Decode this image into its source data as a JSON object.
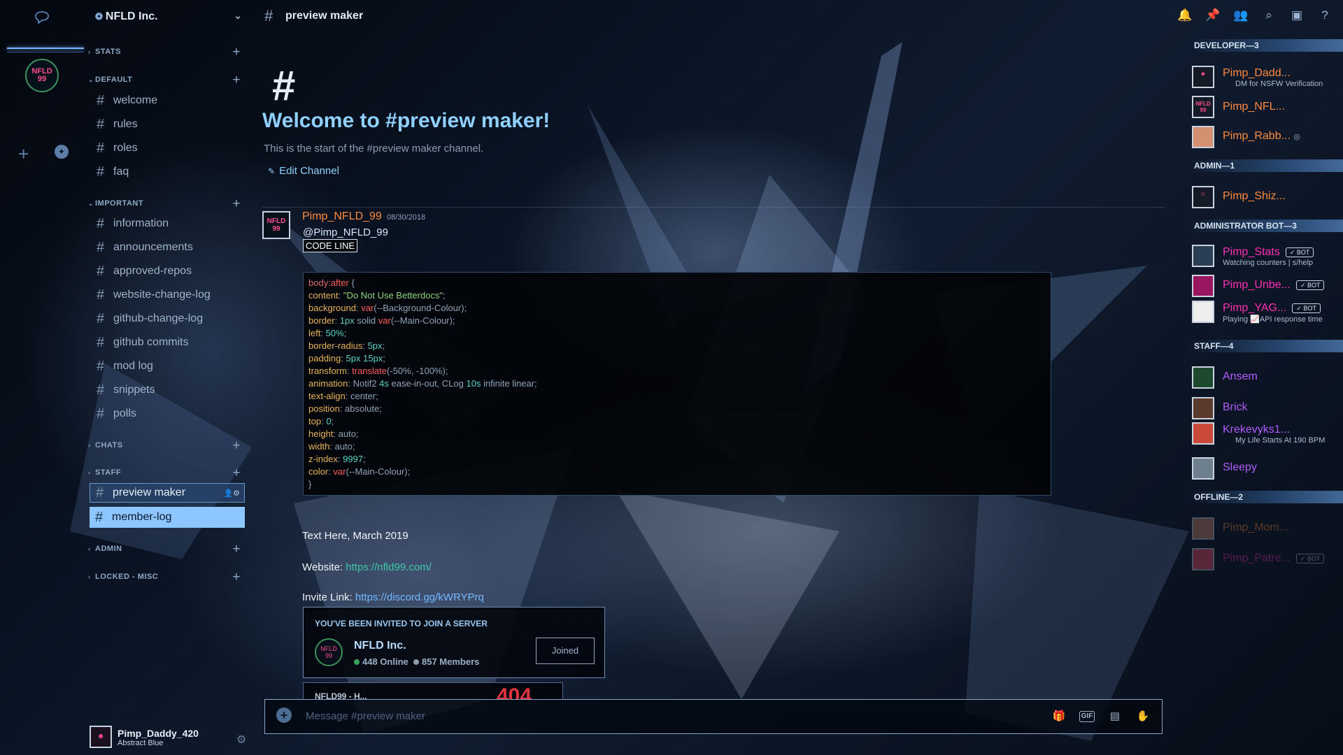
{
  "server": {
    "name": "NFLD Inc.",
    "icon_text": "NFLD 99"
  },
  "channel": {
    "name": "preview maker",
    "welcome_title": "Welcome to #preview maker!",
    "welcome_sub": "This is the start of the #preview maker channel.",
    "edit_label": "Edit Channel"
  },
  "categories": [
    {
      "label": "STATS"
    },
    {
      "label": "DEFAULT"
    },
    {
      "label": "IMPORTANT"
    },
    {
      "label": "CHATS"
    },
    {
      "label": "STAFF"
    },
    {
      "label": "ADMIN"
    },
    {
      "label": "LOCKED - MISC"
    }
  ],
  "channels": [
    {
      "name": "welcome"
    },
    {
      "name": "rules"
    },
    {
      "name": "roles"
    },
    {
      "name": "faq"
    },
    {
      "name": "information"
    },
    {
      "name": "announcements"
    },
    {
      "name": "approved-repos"
    },
    {
      "name": "website-change-log"
    },
    {
      "name": "github-change-log"
    },
    {
      "name": "github commits"
    },
    {
      "name": "mod log"
    },
    {
      "name": "snippets"
    },
    {
      "name": "polls"
    },
    {
      "name": "preview maker"
    },
    {
      "name": "member-log"
    }
  ],
  "current_user": {
    "name": "Pimp_Daddy_420",
    "status": "Abstract Blue"
  },
  "message": {
    "author": "Pimp_NFLD_99",
    "timestamp": "08/30/2018",
    "mention": "@Pimp_NFLD_99",
    "inline_code": "CODE LINE",
    "text1": "Text Here, March 2019",
    "website_label": "Website:",
    "website_url": "https://nfld99.com/",
    "invite_label": "Invite Link:",
    "invite_url": "https://discord.gg/kWRYPrq"
  },
  "code_lines": [
    [
      {
        "t": "body",
        "c": "sel"
      },
      {
        "t": ":after",
        "c": "fn"
      },
      {
        "t": " {",
        "c": "txt"
      }
    ],
    [
      {
        "t": "content",
        "c": "prop"
      },
      {
        "t": ": ",
        "c": "txt"
      },
      {
        "t": "\"Do Not Use Betterdocs\"",
        "c": "str"
      },
      {
        "t": ";",
        "c": "txt"
      }
    ],
    [
      {
        "t": "background",
        "c": "prop"
      },
      {
        "t": ": ",
        "c": "txt"
      },
      {
        "t": "var",
        "c": "fn"
      },
      {
        "t": "(--Background-Colour);",
        "c": "txt"
      }
    ],
    [
      {
        "t": "border",
        "c": "prop"
      },
      {
        "t": ": ",
        "c": "txt"
      },
      {
        "t": "1px",
        "c": "num"
      },
      {
        "t": " solid ",
        "c": "txt"
      },
      {
        "t": "var",
        "c": "fn"
      },
      {
        "t": "(--Main-Colour);",
        "c": "txt"
      }
    ],
    [
      {
        "t": "left",
        "c": "prop"
      },
      {
        "t": ": ",
        "c": "txt"
      },
      {
        "t": "50%",
        "c": "num"
      },
      {
        "t": ";",
        "c": "txt"
      }
    ],
    [
      {
        "t": "border-radius",
        "c": "prop"
      },
      {
        "t": ": ",
        "c": "txt"
      },
      {
        "t": "5px",
        "c": "num"
      },
      {
        "t": ";",
        "c": "txt"
      }
    ],
    [
      {
        "t": "padding",
        "c": "prop"
      },
      {
        "t": ": ",
        "c": "txt"
      },
      {
        "t": "5px 15px",
        "c": "num"
      },
      {
        "t": ";",
        "c": "txt"
      }
    ],
    [
      {
        "t": "transform",
        "c": "prop"
      },
      {
        "t": ": ",
        "c": "txt"
      },
      {
        "t": "translate",
        "c": "fn"
      },
      {
        "t": "(-50%, -100%);",
        "c": "txt"
      }
    ],
    [
      {
        "t": "animation",
        "c": "prop"
      },
      {
        "t": ": Notif2 ",
        "c": "txt"
      },
      {
        "t": "4s",
        "c": "num"
      },
      {
        "t": " ease-in-out, CLog ",
        "c": "txt"
      },
      {
        "t": "10s",
        "c": "num"
      },
      {
        "t": " infinite linear;",
        "c": "txt"
      }
    ],
    [
      {
        "t": "text-align",
        "c": "prop"
      },
      {
        "t": ": center;",
        "c": "txt"
      }
    ],
    [
      {
        "t": "position",
        "c": "prop"
      },
      {
        "t": ": absolute;",
        "c": "txt"
      }
    ],
    [
      {
        "t": "top",
        "c": "prop"
      },
      {
        "t": ": ",
        "c": "txt"
      },
      {
        "t": "0",
        "c": "num"
      },
      {
        "t": ";",
        "c": "txt"
      }
    ],
    [
      {
        "t": "height",
        "c": "prop"
      },
      {
        "t": ": auto;",
        "c": "txt"
      }
    ],
    [
      {
        "t": "width",
        "c": "prop"
      },
      {
        "t": ": auto;",
        "c": "txt"
      }
    ],
    [
      {
        "t": "z-index",
        "c": "prop"
      },
      {
        "t": ": ",
        "c": "txt"
      },
      {
        "t": "9997",
        "c": "num"
      },
      {
        "t": ";",
        "c": "txt"
      }
    ],
    [
      {
        "t": "color",
        "c": "prop"
      },
      {
        "t": ": ",
        "c": "txt"
      },
      {
        "t": "var",
        "c": "fn"
      },
      {
        "t": "(--Main-Colour);",
        "c": "txt"
      }
    ],
    [
      {
        "t": "}",
        "c": "txt"
      }
    ]
  ],
  "invite": {
    "header": "YOU'VE BEEN INVITED TO JOIN A SERVER",
    "server_name": "NFLD Inc.",
    "online": "448 Online",
    "members": "857 Members",
    "button": "Joined"
  },
  "embed_peek": {
    "title": "NFLD99 - H...",
    "number": "404"
  },
  "composer": {
    "placeholder": "Message #preview maker"
  },
  "member_groups": [
    {
      "label": "DEVELOPER—3"
    },
    {
      "label": "ADMIN—1"
    },
    {
      "label": "ADMINISTRATOR BOT—3"
    },
    {
      "label": "STAFF—4"
    },
    {
      "label": "OFFLINE—2"
    }
  ],
  "members": [
    {
      "name": "Pimp_Dadd...",
      "sub": "DM for NSFW Verification"
    },
    {
      "name": "Pimp_NFL...",
      "sub": ""
    },
    {
      "name": "Pimp_Rabb...",
      "sub": ""
    },
    {
      "name": "Pimp_Shiz...",
      "sub": ""
    },
    {
      "name": "Pimp_Stats",
      "sub": "Watching counters | s/help",
      "bot": "✓ BOT"
    },
    {
      "name": "Pimp_Unbe...",
      "sub": "",
      "bot": "✓ BOT"
    },
    {
      "name": "Pimp_YAG...",
      "sub": "Playing 📈API response time",
      "bot": "✓ BOT"
    },
    {
      "name": "Ansem",
      "sub": ""
    },
    {
      "name": "Brick",
      "sub": ""
    },
    {
      "name": "Krekevyks1...",
      "sub": "My Life Starts At 190 BPM"
    },
    {
      "name": "Sleepy",
      "sub": ""
    },
    {
      "name": "Pimp_Mom...",
      "sub": ""
    },
    {
      "name": "Pimp_Patre...",
      "sub": "",
      "bot": "✓ BOT"
    }
  ],
  "colors": {
    "accent": "#8fd0ff",
    "author": "#ff8a3d",
    "bot_role": "#ff2fb4",
    "staff_role": "#b25bff",
    "online": "#3ba55d"
  },
  "icons": [
    "chat-bubble-icon",
    "compass-icon",
    "bell-icon",
    "pin-icon",
    "members-icon",
    "search-icon",
    "inbox-icon",
    "help-icon",
    "gift-icon",
    "gif-icon",
    "sticker-icon",
    "emoji-icon"
  ]
}
